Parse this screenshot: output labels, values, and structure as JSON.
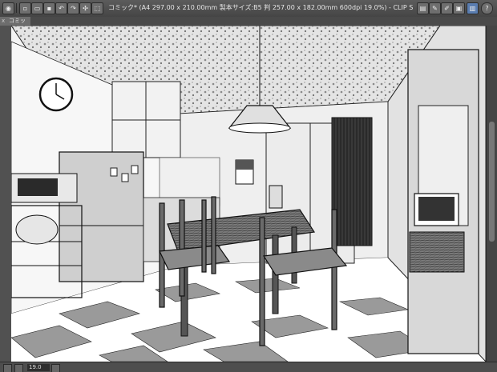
{
  "app": {
    "window_title": "コミック* (A4 297.00 x 210.00mm 製本サイズ:B5 判 257.00 x 182.00mm 600dpi 19.0%) - CLIP STUDIO PAINT EX"
  },
  "tabs": [
    {
      "label": "コミック",
      "close_glyph": "x"
    }
  ],
  "statusbar": {
    "zoom": "19.0"
  },
  "colors": {
    "ui_dark": "#3a3a3a",
    "ui_panel": "#4e4e4e",
    "canvas_white": "#ffffff",
    "ink": "#1a1a1a",
    "floor_gray": "#9a9a9a"
  }
}
